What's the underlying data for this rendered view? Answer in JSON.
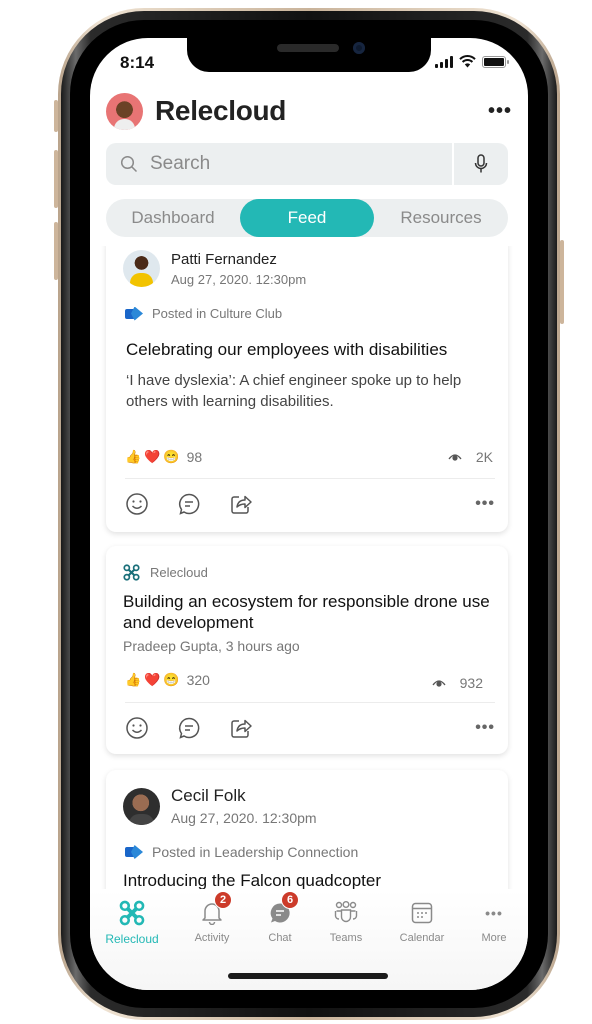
{
  "status_bar": {
    "time": "8:14"
  },
  "header": {
    "title": "Relecloud",
    "more_label": "•••"
  },
  "search": {
    "placeholder": "Search",
    "value": ""
  },
  "tabs": [
    {
      "label": "Dashboard",
      "active": false
    },
    {
      "label": "Feed",
      "active": true
    },
    {
      "label": "Resources",
      "active": false
    }
  ],
  "feed": {
    "posts": [
      {
        "author": "Patti Fernandez",
        "date": "Aug 27, 2020. 12:30pm",
        "posted_in": "Posted in Culture Club",
        "title": "Celebrating our employees with disabilities",
        "body": "‘I have dyslexia’: A chief engineer spoke up to help others with learning disabilities.",
        "reactions": [
          "👍",
          "❤️",
          "😁"
        ],
        "reaction_count": "98",
        "views": "2K"
      },
      {
        "source": "Relecloud",
        "title": "Building an ecosystem for responsible drone use and development",
        "byline": "Pradeep Gupta, 3 hours ago",
        "reactions": [
          "👍",
          "❤️",
          "😁"
        ],
        "reaction_count": "320",
        "views": "932"
      },
      {
        "author": "Cecil Folk",
        "date": "Aug 27, 2020. 12:30pm",
        "posted_in": "Posted in Leadership Connection",
        "title": "Introducing the Falcon quadcopter"
      }
    ],
    "more_label": "•••"
  },
  "bottom_nav": {
    "items": [
      {
        "label": "Relecloud",
        "icon": "drone-icon",
        "active": true
      },
      {
        "label": "Activity",
        "icon": "bell-icon",
        "badge": "2"
      },
      {
        "label": "Chat",
        "icon": "chat-icon",
        "badge": "6"
      },
      {
        "label": "Teams",
        "icon": "teams-icon"
      },
      {
        "label": "Calendar",
        "icon": "calendar-icon"
      },
      {
        "label": "More",
        "icon": "more-icon",
        "glyph": "•••"
      }
    ]
  },
  "colors": {
    "accent": "#23b8b5",
    "badge": "#cc3b2a",
    "search_bg": "#eceff0"
  }
}
